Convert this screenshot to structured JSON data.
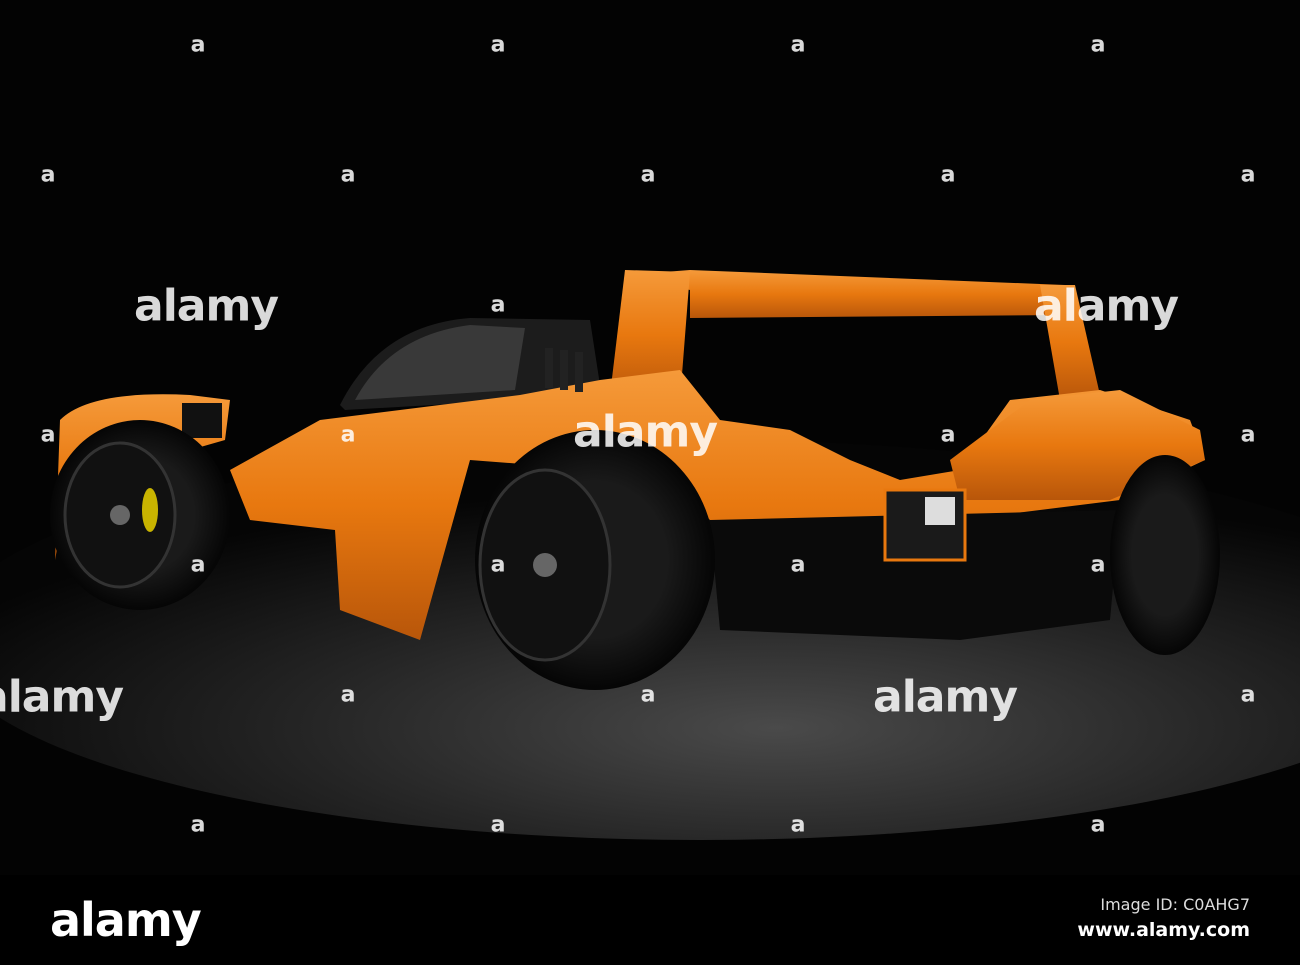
{
  "watermark": {
    "glyph": "a",
    "logo": "alamy"
  },
  "footer": {
    "logo": "alamy",
    "image_id": "Image ID: C0AHG7",
    "url": "www.alamy.com"
  },
  "colors": {
    "body": "#e8780f",
    "background": "#000000",
    "floor": "#3a3a3a"
  }
}
